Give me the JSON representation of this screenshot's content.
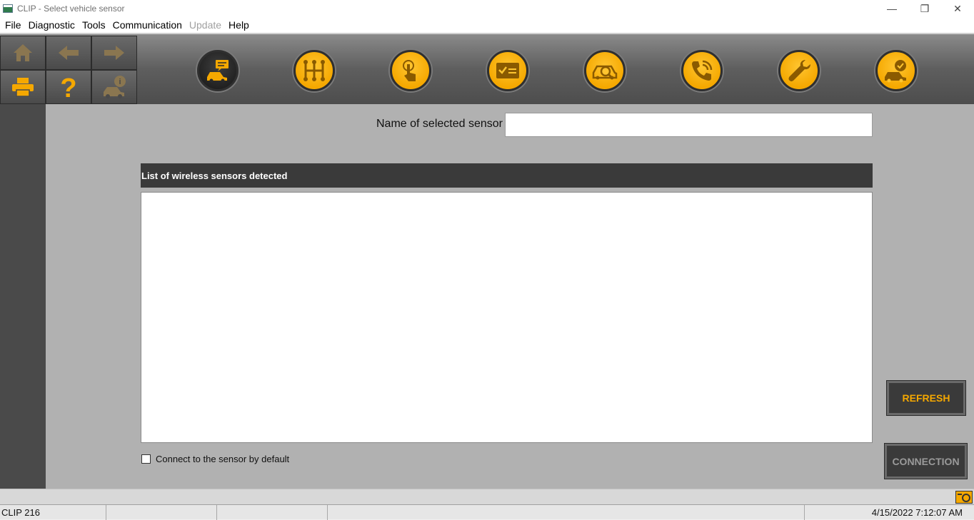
{
  "window": {
    "title": "CLIP - Select vehicle sensor",
    "controls": {
      "minimize": "—",
      "restore": "❐",
      "close": "✕"
    }
  },
  "menu": {
    "items": [
      {
        "label": "File",
        "enabled": true
      },
      {
        "label": "Diagnostic",
        "enabled": true
      },
      {
        "label": "Tools",
        "enabled": true
      },
      {
        "label": "Communication",
        "enabled": true
      },
      {
        "label": "Update",
        "enabled": false
      },
      {
        "label": "Help",
        "enabled": true
      }
    ]
  },
  "toolbar": {
    "nav_buttons": [
      {
        "name": "home-icon",
        "enabled": false
      },
      {
        "name": "back-arrow-icon",
        "enabled": false
      },
      {
        "name": "forward-arrow-icon",
        "enabled": false
      },
      {
        "name": "printer-icon",
        "enabled": true
      },
      {
        "name": "help-question-icon",
        "enabled": true
      },
      {
        "name": "vehicle-info-icon",
        "enabled": false
      }
    ],
    "tools": [
      {
        "name": "vehicle-identification-icon",
        "active": true
      },
      {
        "name": "gearbox-icon",
        "active": false
      },
      {
        "name": "touch-command-icon",
        "active": false
      },
      {
        "name": "checklist-icon",
        "active": false
      },
      {
        "name": "vehicle-search-icon",
        "active": false
      },
      {
        "name": "phone-support-icon",
        "active": false
      },
      {
        "name": "wrench-icon",
        "active": false
      },
      {
        "name": "vehicle-check-icon",
        "active": false
      }
    ],
    "accent_color": "#f5a800"
  },
  "main": {
    "sensor_label": "Name of selected sensor",
    "sensor_value": "",
    "list_header": "List of wireless sensors detected",
    "list_items": [],
    "default_connect_label": "Connect to the sensor by default",
    "default_connect_checked": false,
    "refresh_label": "REFRESH",
    "connection_label": "CONNECTION"
  },
  "statusbar": {
    "app": "CLIP 216",
    "cell2": "",
    "cell3": "",
    "cell4": "",
    "datetime": "4/15/2022 7:12:07 AM"
  }
}
